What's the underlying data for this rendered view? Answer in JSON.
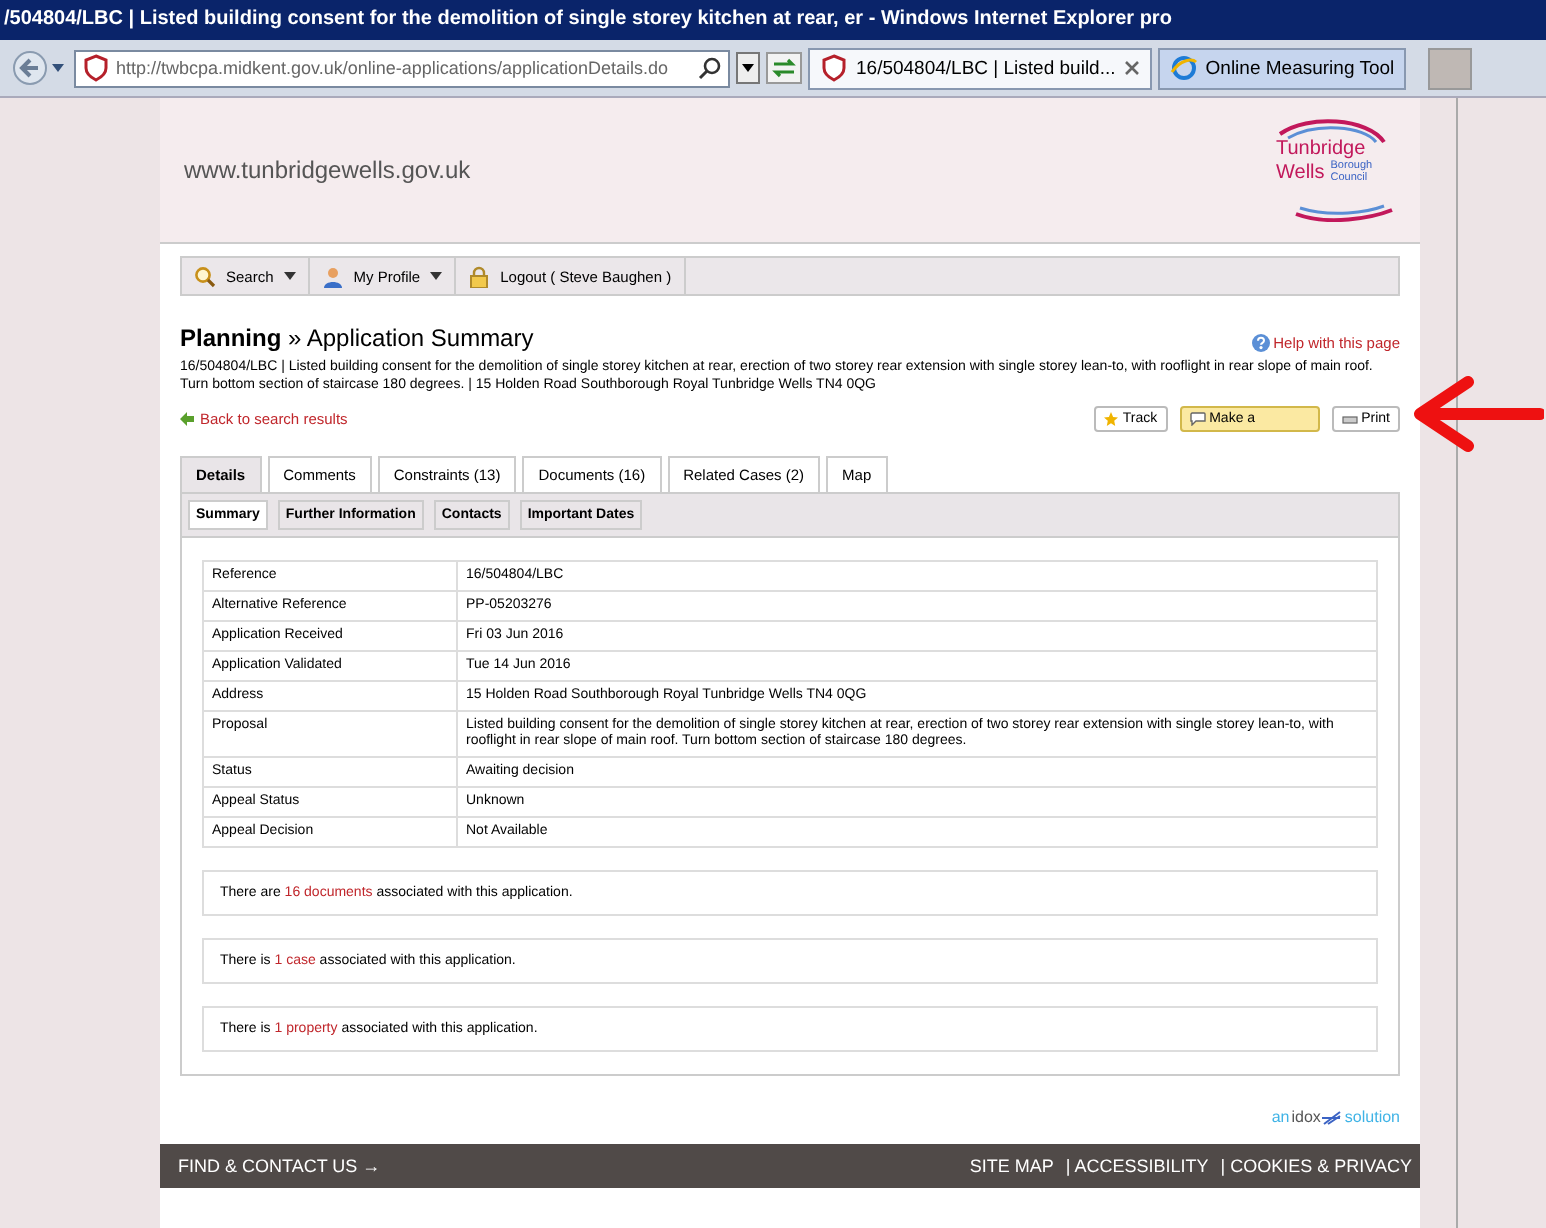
{
  "browser": {
    "title": "/504804/LBC | Listed building consent for the demolition of single storey kitchen at rear, er - Windows Internet Explorer pro",
    "address": "http://twbcpa.midkent.gov.uk/online-applications/applicationDetails.do",
    "tabs": [
      {
        "label": "16/504804/LBC | Listed build...",
        "selected": true
      },
      {
        "label": "Online Measuring Tool",
        "selected": false
      }
    ]
  },
  "header": {
    "site_url": "www.tunbridgewells.gov.uk",
    "logo": [
      "Tunbridge",
      "Wells",
      "Borough",
      "Council"
    ]
  },
  "nav": [
    {
      "label": "Search",
      "has_menu": true
    },
    {
      "label": "My Profile",
      "has_menu": true
    },
    {
      "label": "Logout  ( Steve Baughen )",
      "has_menu": false
    }
  ],
  "heading": "**Planning** » Application Summary",
  "help_link": "Help with this page",
  "description": "16/504804/LBC | Listed building consent for the demolition of single storey kitchen at rear, erection of two storey rear extension with single storey lean-to, with rooflight in rear slope of main roof. Turn bottom section of staircase 180 degrees. | 15 Holden Road Southborough Royal Tunbridge Wells TN4 0QG",
  "back_link": "Back to search results",
  "actions": [
    {
      "label": "Track",
      "kind": "track"
    },
    {
      "label": "Make a",
      "kind": "comment"
    },
    {
      "label": "Print",
      "kind": "print"
    }
  ],
  "tabs": [
    {
      "label": "Details",
      "selected": true
    },
    {
      "label": "Comments",
      "selected": false
    },
    {
      "label": "Constraints (13)",
      "selected": false
    },
    {
      "label": "Documents (16)",
      "selected": false
    },
    {
      "label": "Related Cases (2)",
      "selected": false
    },
    {
      "label": "Map",
      "selected": false
    }
  ],
  "subtabs": [
    {
      "label": "Summary",
      "selected": true
    },
    {
      "label": "Further Information",
      "selected": false
    },
    {
      "label": "Contacts",
      "selected": false
    },
    {
      "label": "Important Dates",
      "selected": false
    }
  ],
  "details": [
    [
      "Reference",
      "16/504804/LBC"
    ],
    [
      "Alternative Reference",
      "PP-05203276"
    ],
    [
      "Application Received",
      "Fri 03 Jun 2016"
    ],
    [
      "Application Validated",
      "Tue 14 Jun 2016"
    ],
    [
      "Address",
      "15 Holden Road Southborough Royal Tunbridge Wells TN4 0QG"
    ],
    [
      "Proposal",
      "Listed building consent for the demolition of single storey kitchen at rear, erection of two storey rear extension with single storey lean-to, with rooflight in rear slope of main roof. Turn bottom section of staircase 180 degrees."
    ],
    [
      "Status",
      "Awaiting decision"
    ],
    [
      "Appeal Status",
      "Unknown"
    ],
    [
      "Appeal Decision",
      "Not Available"
    ]
  ],
  "notices": [
    {
      "before": "There are",
      "link": "16 documents",
      "after": "associated with this application."
    },
    {
      "before": "There is",
      "link": "1 case",
      "after": "associated with this application."
    },
    {
      "before": "There is",
      "link": "1 property",
      "after": "associated with this application."
    }
  ],
  "vendor": [
    "an",
    "idox",
    "solution"
  ],
  "footer": {
    "contact": "FIND & CONTACT US →",
    "links": [
      "SITE MAP",
      "| ACCESSIBILITY",
      "| COOKIES & PRIVACY"
    ]
  }
}
